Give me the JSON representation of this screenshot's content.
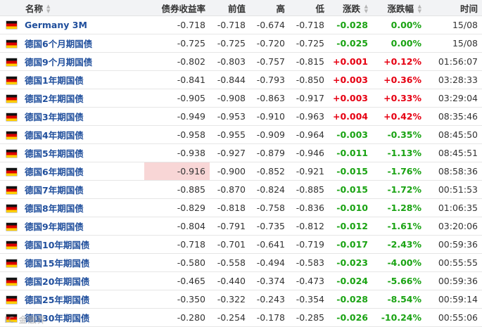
{
  "headers": {
    "name": "名称",
    "yield": "债券收益率",
    "prev": "前值",
    "high": "高",
    "low": "低",
    "change": "涨跌",
    "change_pct": "涨跌幅",
    "time": "时间"
  },
  "colors": {
    "up": "#e60012",
    "down": "#1aa313",
    "link": "#1f4e9c",
    "highlight": "#f8d6d6"
  },
  "rows": [
    {
      "name": "Germany 3M",
      "yield": "-0.718",
      "prev": "-0.718",
      "high": "-0.674",
      "low": "-0.718",
      "change": "-0.028",
      "change_pct": "0.00%",
      "time": "15/08",
      "dir": "down"
    },
    {
      "name": "德国6个月期国债",
      "yield": "-0.725",
      "prev": "-0.725",
      "high": "-0.720",
      "low": "-0.725",
      "change": "-0.025",
      "change_pct": "0.00%",
      "time": "15/08",
      "dir": "down"
    },
    {
      "name": "德国9个月期国债",
      "yield": "-0.802",
      "prev": "-0.803",
      "high": "-0.757",
      "low": "-0.815",
      "change": "+0.001",
      "change_pct": "+0.12%",
      "time": "01:56:07",
      "dir": "up"
    },
    {
      "name": "德国1年期国债",
      "yield": "-0.841",
      "prev": "-0.844",
      "high": "-0.793",
      "low": "-0.850",
      "change": "+0.003",
      "change_pct": "+0.36%",
      "time": "03:28:33",
      "dir": "up"
    },
    {
      "name": "德国2年期国债",
      "yield": "-0.905",
      "prev": "-0.908",
      "high": "-0.863",
      "low": "-0.917",
      "change": "+0.003",
      "change_pct": "+0.33%",
      "time": "03:29:04",
      "dir": "up"
    },
    {
      "name": "德国3年期国债",
      "yield": "-0.949",
      "prev": "-0.953",
      "high": "-0.910",
      "low": "-0.963",
      "change": "+0.004",
      "change_pct": "+0.42%",
      "time": "08:35:46",
      "dir": "up"
    },
    {
      "name": "德国4年期国债",
      "yield": "-0.958",
      "prev": "-0.955",
      "high": "-0.909",
      "low": "-0.964",
      "change": "-0.003",
      "change_pct": "-0.35%",
      "time": "08:45:50",
      "dir": "down"
    },
    {
      "name": "德国5年期国债",
      "yield": "-0.938",
      "prev": "-0.927",
      "high": "-0.879",
      "low": "-0.946",
      "change": "-0.011",
      "change_pct": "-1.13%",
      "time": "08:45:51",
      "dir": "down"
    },
    {
      "name": "德国6年期国债",
      "yield": "-0.916",
      "prev": "-0.900",
      "high": "-0.852",
      "low": "-0.921",
      "change": "-0.015",
      "change_pct": "-1.76%",
      "time": "08:58:36",
      "dir": "down",
      "highlight": true
    },
    {
      "name": "德国7年期国债",
      "yield": "-0.885",
      "prev": "-0.870",
      "high": "-0.824",
      "low": "-0.885",
      "change": "-0.015",
      "change_pct": "-1.72%",
      "time": "00:51:53",
      "dir": "down"
    },
    {
      "name": "德国8年期国债",
      "yield": "-0.829",
      "prev": "-0.818",
      "high": "-0.758",
      "low": "-0.836",
      "change": "-0.010",
      "change_pct": "-1.28%",
      "time": "01:06:35",
      "dir": "down"
    },
    {
      "name": "德国9年期国债",
      "yield": "-0.804",
      "prev": "-0.791",
      "high": "-0.735",
      "low": "-0.812",
      "change": "-0.012",
      "change_pct": "-1.61%",
      "time": "03:20:06",
      "dir": "down"
    },
    {
      "name": "德国10年期国债",
      "yield": "-0.718",
      "prev": "-0.701",
      "high": "-0.641",
      "low": "-0.719",
      "change": "-0.017",
      "change_pct": "-2.43%",
      "time": "00:59:36",
      "dir": "down"
    },
    {
      "name": "德国15年期国债",
      "yield": "-0.580",
      "prev": "-0.558",
      "high": "-0.494",
      "low": "-0.583",
      "change": "-0.023",
      "change_pct": "-4.00%",
      "time": "00:55:55",
      "dir": "down"
    },
    {
      "name": "德国20年期国债",
      "yield": "-0.465",
      "prev": "-0.440",
      "high": "-0.374",
      "low": "-0.473",
      "change": "-0.024",
      "change_pct": "-5.66%",
      "time": "00:59:36",
      "dir": "down"
    },
    {
      "name": "德国25年期国债",
      "yield": "-0.350",
      "prev": "-0.322",
      "high": "-0.243",
      "low": "-0.354",
      "change": "-0.028",
      "change_pct": "-8.54%",
      "time": "00:59:14",
      "dir": "down"
    },
    {
      "name": "德国30年期国债",
      "yield": "-0.280",
      "prev": "-0.254",
      "high": "-0.178",
      "low": "-0.285",
      "change": "-0.026",
      "change_pct": "-10.24%",
      "time": "00:55:06",
      "dir": "down"
    }
  ]
}
